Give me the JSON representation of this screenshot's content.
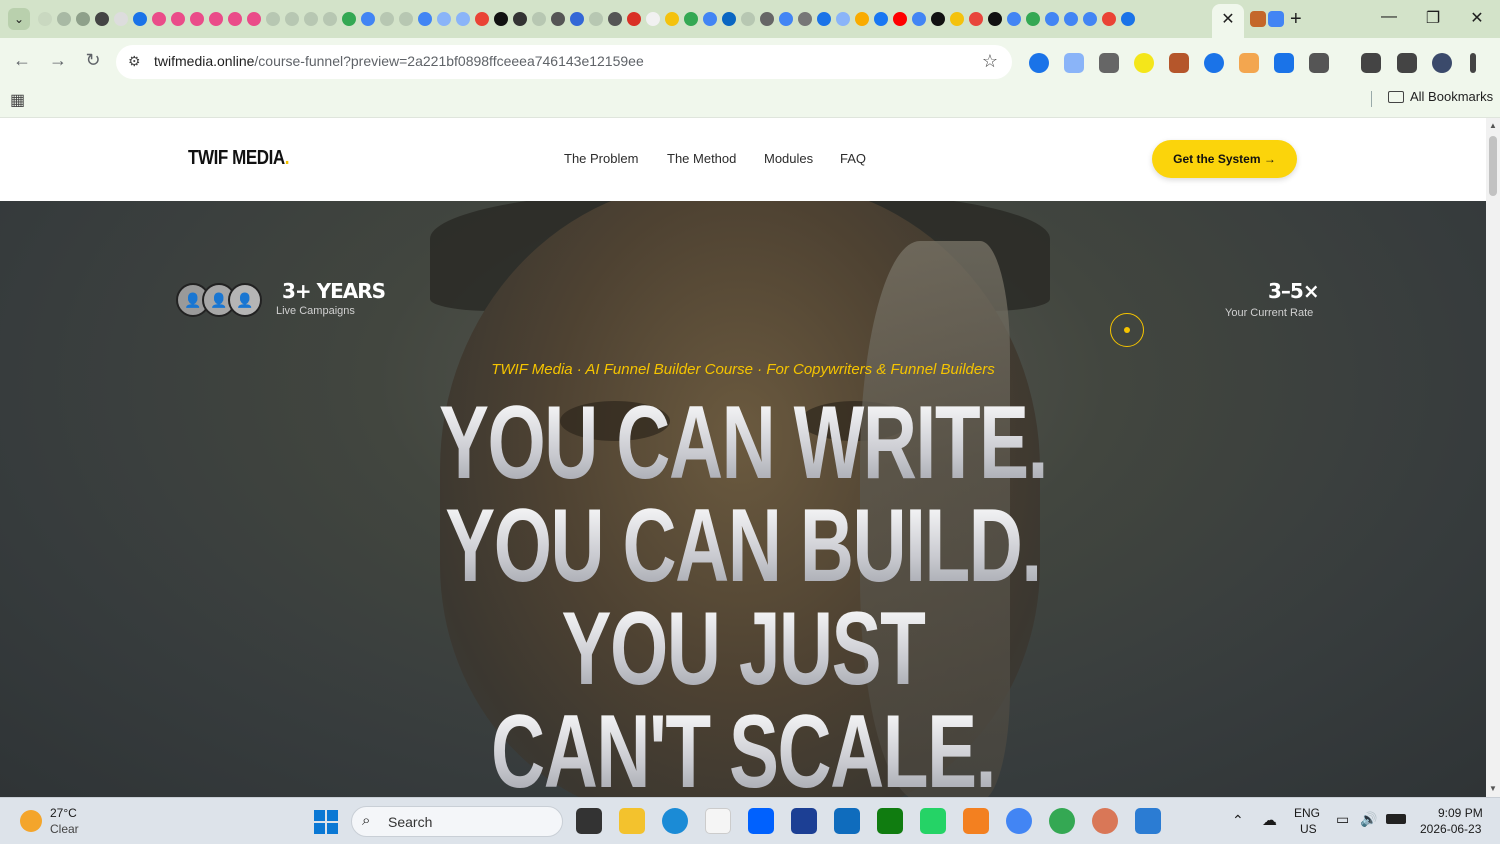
{
  "browser": {
    "url_host": "twifmedia.online",
    "url_path": "/course-funnel?preview=2a221bf0898ffceeea746143e12159ee",
    "bookmarks_all": "All Bookmarks"
  },
  "site": {
    "logo_text": "TWIF MEDIA",
    "logo_dot": ".",
    "nav": [
      "The Problem",
      "The Method",
      "Modules",
      "FAQ"
    ],
    "cta_label": "Get the System",
    "cta_arrow": "→",
    "accent_color": "#fbd40b"
  },
  "hero": {
    "stat_left_value": "3+ YEARS",
    "stat_left_label": "Live Campaigns",
    "stat_right_value": "3–5×",
    "stat_right_label": "Your Current Rate",
    "tagline": "TWIF Media · AI Funnel Builder Course · For Copywriters & Funnel Builders",
    "headline": [
      "YOU CAN WRITE.",
      "YOU CAN BUILD.",
      "YOU JUST",
      "CAN'T SCALE."
    ]
  },
  "taskbar": {
    "weather_temp": "27°C",
    "weather_desc": "Clear",
    "search_placeholder": "Search",
    "lang_top": "ENG",
    "lang_bottom": "US",
    "time": "9:09 PM",
    "date": "2026-06-23"
  }
}
